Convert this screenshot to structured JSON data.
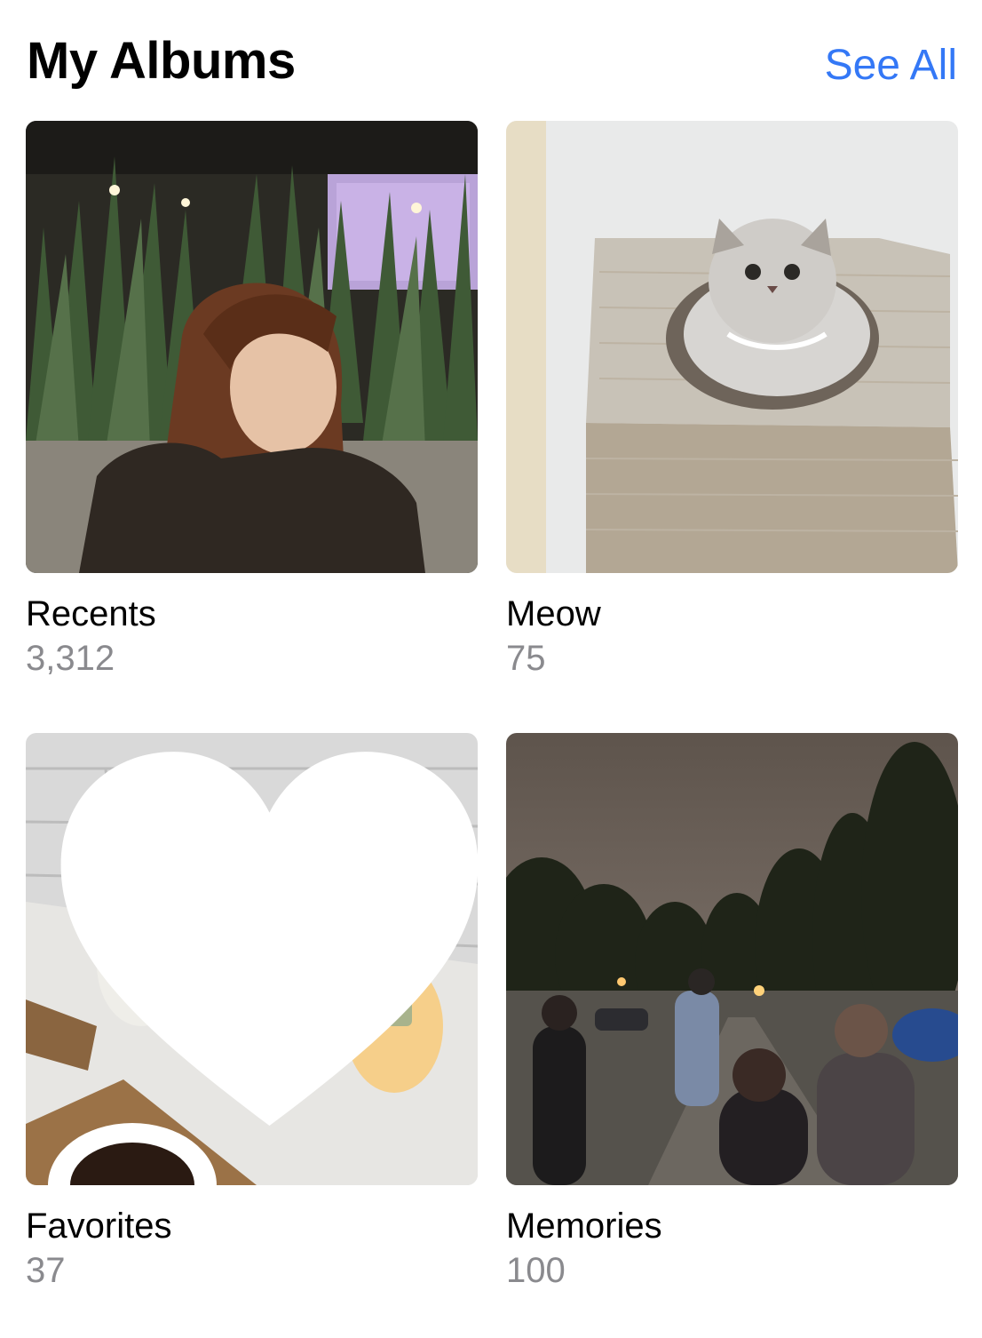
{
  "header": {
    "title": "My Albums",
    "see_all_label": "See All"
  },
  "accent_color": "#3478F6",
  "albums": [
    {
      "name": "Recents",
      "count": "3,312",
      "thumbnail": "woman-near-plants-photo"
    },
    {
      "name": "Meow",
      "count": "75",
      "thumbnail": "cat-in-box-photo"
    },
    {
      "name": "Favorites",
      "count": "37",
      "thumbnail": "plush-toys-photo",
      "badge_icon": "heart-icon"
    },
    {
      "name": "Memories",
      "count": "100",
      "thumbnail": "night-street-photo"
    }
  ]
}
